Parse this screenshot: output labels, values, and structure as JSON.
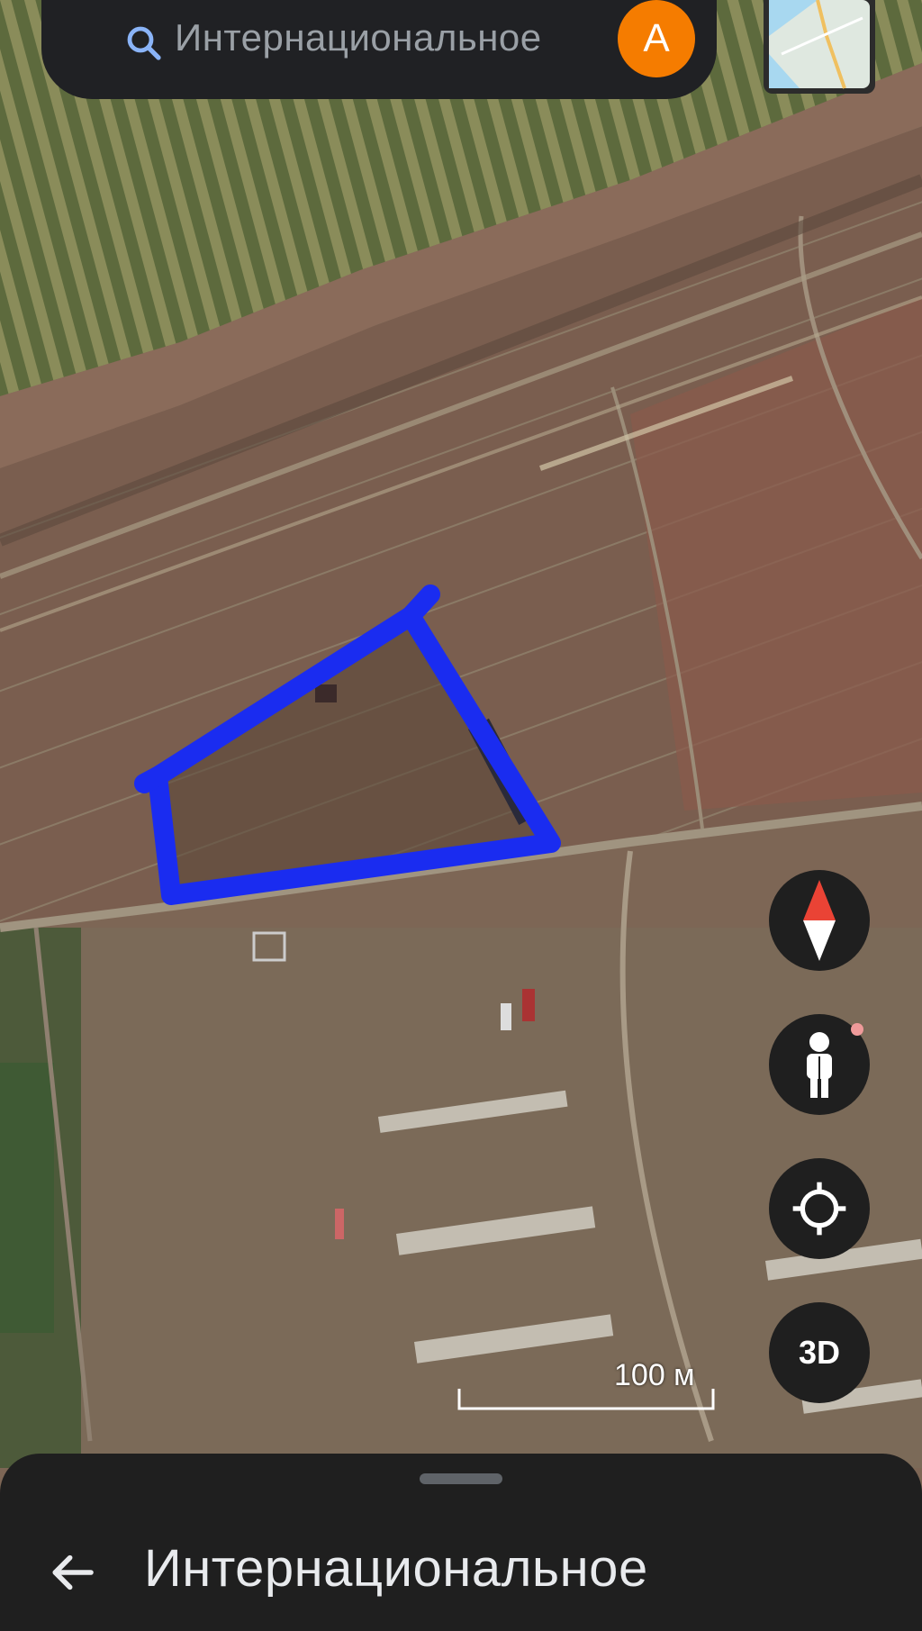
{
  "search": {
    "query": "Интернациональное",
    "avatar_letter": "A",
    "avatar_color": "#f57c00"
  },
  "map": {
    "scale_label": "100 м",
    "polygon_color": "#1a2cf0"
  },
  "controls": {
    "three_d_label": "3D",
    "compass_icon": "compass-icon",
    "pegman_icon": "street-view-pegman-icon",
    "locate_icon": "my-location-icon"
  },
  "bottom_sheet": {
    "title": "Интернациональное",
    "back_icon": "arrow-back-icon"
  }
}
